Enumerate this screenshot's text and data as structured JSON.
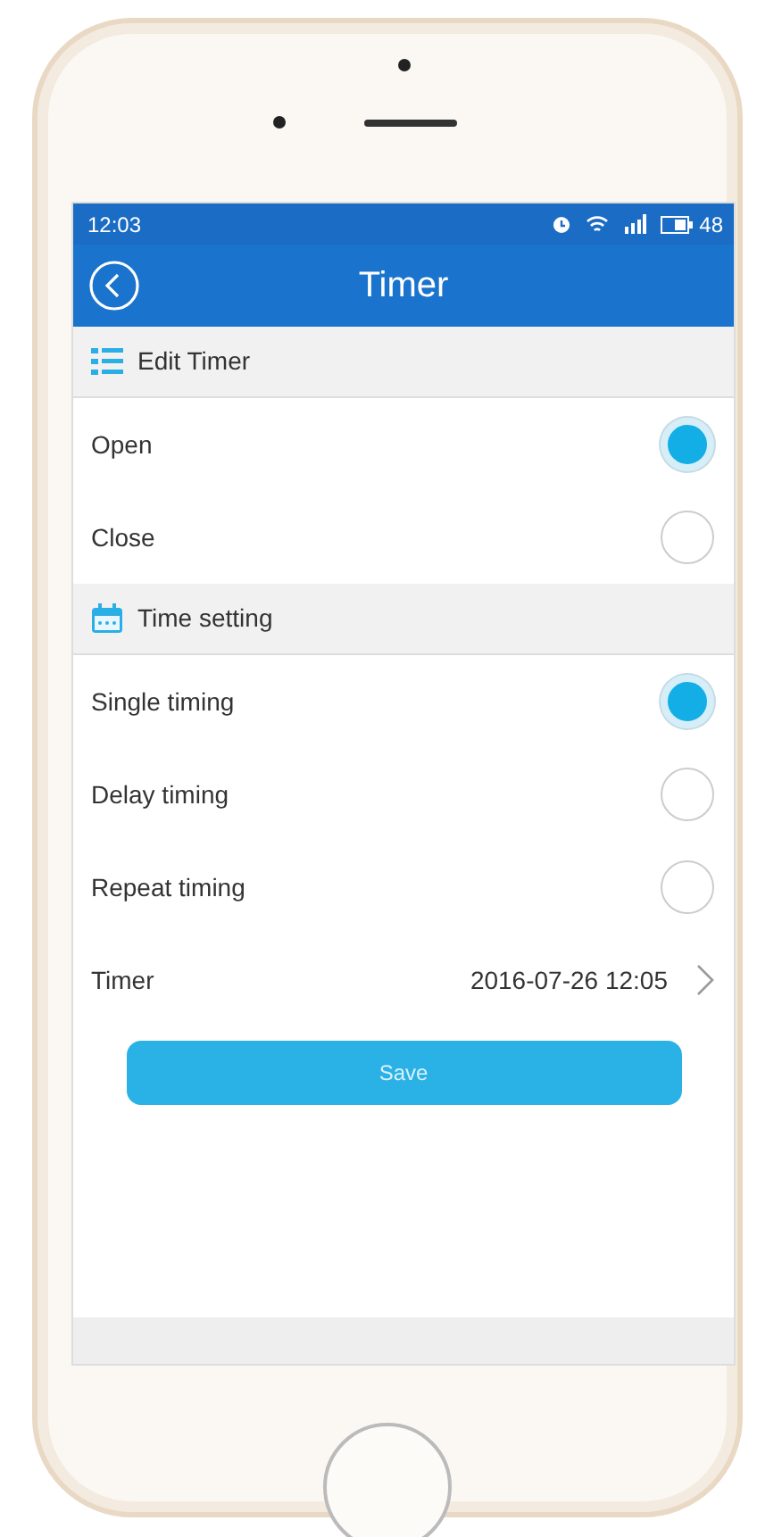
{
  "status_bar": {
    "time": "12:03",
    "battery": "48"
  },
  "header": {
    "title": "Timer"
  },
  "sections": [
    {
      "title": "Edit Timer",
      "kind": "list",
      "options": [
        {
          "label": "Open",
          "selected": true
        },
        {
          "label": "Close",
          "selected": false
        }
      ]
    },
    {
      "title": "Time setting",
      "kind": "calendar",
      "options": [
        {
          "label": "Single timing",
          "selected": true
        },
        {
          "label": "Delay timing",
          "selected": false
        },
        {
          "label": "Repeat timing",
          "selected": false
        }
      ]
    }
  ],
  "timer_row": {
    "label": "Timer",
    "value": "2016-07-26 12:05"
  },
  "save_button": "Save"
}
